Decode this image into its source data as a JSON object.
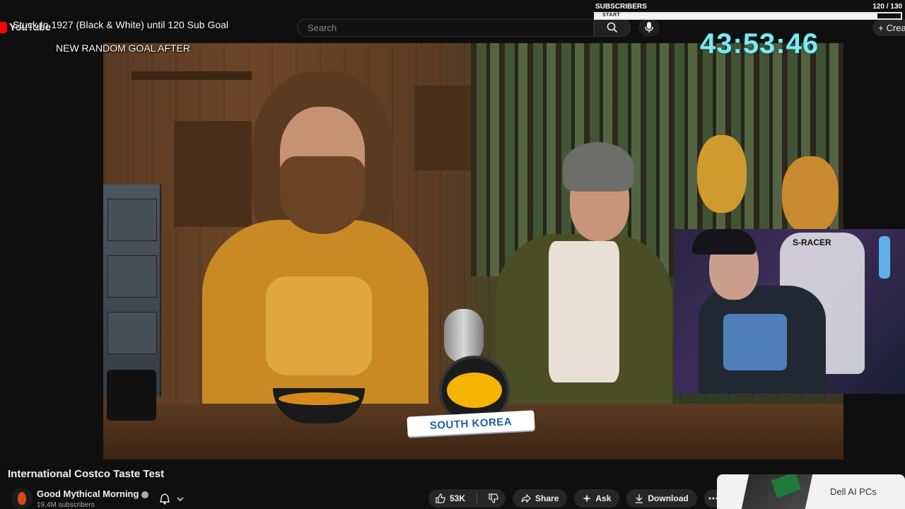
{
  "app": {
    "logo_text": "YouTube"
  },
  "header": {
    "search_placeholder": "Search",
    "create_label": "Crea"
  },
  "overlay": {
    "goal_title": "Stuck In 1927 (Black & White) until 120 Sub Goal",
    "goal_subtitle": "NEW RANDOM GOAL AFTER",
    "timer": "43:53:46"
  },
  "subscribers_widget": {
    "label": "SUBSCRIBERS",
    "count": "120 / 130",
    "start_label": "START",
    "progress_fraction": 0.923
  },
  "video_content": {
    "banner_text": "SOUTH KOREA",
    "chair_brand": "S-RACER"
  },
  "video": {
    "title": "International Costco Taste Test",
    "channel_name": "Good Mythical Morning",
    "subscribers": "19.4M subscribers",
    "likes": "53K",
    "share_label": "Share",
    "ask_label": "Ask",
    "download_label": "Download"
  },
  "ad": {
    "text": "Dell AI PCs"
  },
  "icons": {
    "search": "search-icon",
    "mic": "mic-icon",
    "bell": "bell-icon",
    "like": "thumbs-up-icon",
    "dislike": "thumbs-down-icon",
    "share": "share-icon",
    "ask": "sparkle-icon",
    "download": "download-icon",
    "more": "more-horiz-icon"
  },
  "colors": {
    "timer": "#7ee9f0",
    "logo_red": "#ff0000",
    "banner_text": "#1e5fa8"
  }
}
